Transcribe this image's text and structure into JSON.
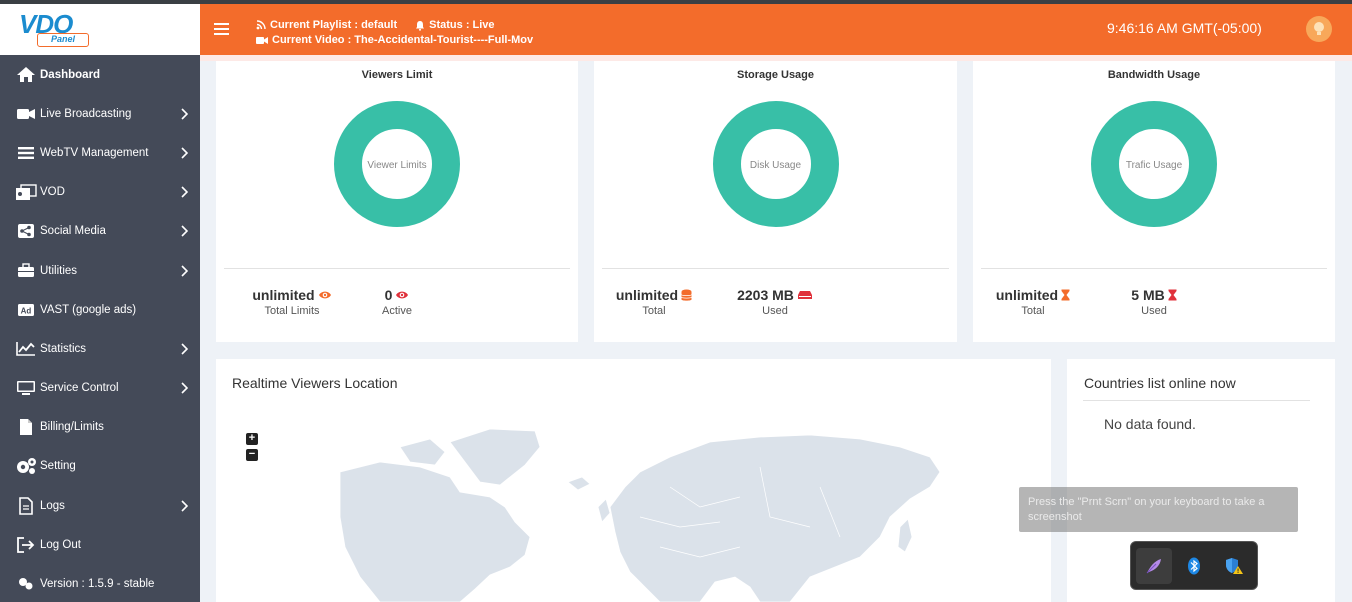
{
  "logo": {
    "brand": "VDO",
    "sub": "Panel"
  },
  "header": {
    "playlist_label": "Current Playlist : default",
    "status_label": "Status : Live",
    "video_label": "Current Video : The-Accidental-Tourist----Full-Mov",
    "clock": "9:46:16 AM GMT(-05:00)"
  },
  "sidebar": {
    "items": [
      {
        "label": "Dashboard",
        "icon": "home-icon",
        "has_chevron": false
      },
      {
        "label": "Live Broadcasting",
        "icon": "video-camera-icon",
        "has_chevron": true
      },
      {
        "label": "WebTV Management",
        "icon": "list-icon",
        "has_chevron": true
      },
      {
        "label": "VOD",
        "icon": "film-icon",
        "has_chevron": true
      },
      {
        "label": "Social Media",
        "icon": "share-icon",
        "has_chevron": true
      },
      {
        "label": "Utilities",
        "icon": "briefcase-icon",
        "has_chevron": true
      },
      {
        "label": "VAST (google ads)",
        "icon": "ad-icon",
        "has_chevron": false
      },
      {
        "label": "Statistics",
        "icon": "chart-icon",
        "has_chevron": true
      },
      {
        "label": "Service Control",
        "icon": "monitor-icon",
        "has_chevron": true
      },
      {
        "label": "Billing/Limits",
        "icon": "document-icon",
        "has_chevron": false
      },
      {
        "label": "Setting",
        "icon": "gears-icon",
        "has_chevron": false
      },
      {
        "label": "Logs",
        "icon": "file-icon",
        "has_chevron": true
      },
      {
        "label": "Log Out",
        "icon": "logout-icon",
        "has_chevron": false
      },
      {
        "label": "Version : 1.5.9 - stable",
        "icon": "tag-icon",
        "has_chevron": false
      }
    ]
  },
  "cards": {
    "viewers": {
      "title": "Viewers Limit",
      "center": "Viewer Limits",
      "left_value": "unlimited",
      "left_label": "Total Limits",
      "right_value": "0",
      "right_label": "Active"
    },
    "storage": {
      "title": "Storage Usage",
      "center": "Disk Usage",
      "left_value": "unlimited",
      "left_label": "Total",
      "right_value": "2203 MB",
      "right_label": "Used"
    },
    "bandwidth": {
      "title": "Bandwidth Usage",
      "center": "Trafic Usage",
      "left_value": "unlimited",
      "left_label": "Total",
      "right_value": "5 MB",
      "right_label": "Used"
    }
  },
  "map_panel": {
    "title": "Realtime Viewers Location",
    "zoom_in": "+",
    "zoom_out": "−"
  },
  "countries_panel": {
    "title": "Countries list online now",
    "empty": "No data found."
  },
  "tooltip": {
    "text": "Press the \"Prnt Scrn\" on your keyboard to take a screenshot"
  },
  "colors": {
    "accent": "#f36c2b",
    "sidebar": "#444a58",
    "donut": "#38bfa7",
    "logo_blue": "#1b8ccf"
  }
}
